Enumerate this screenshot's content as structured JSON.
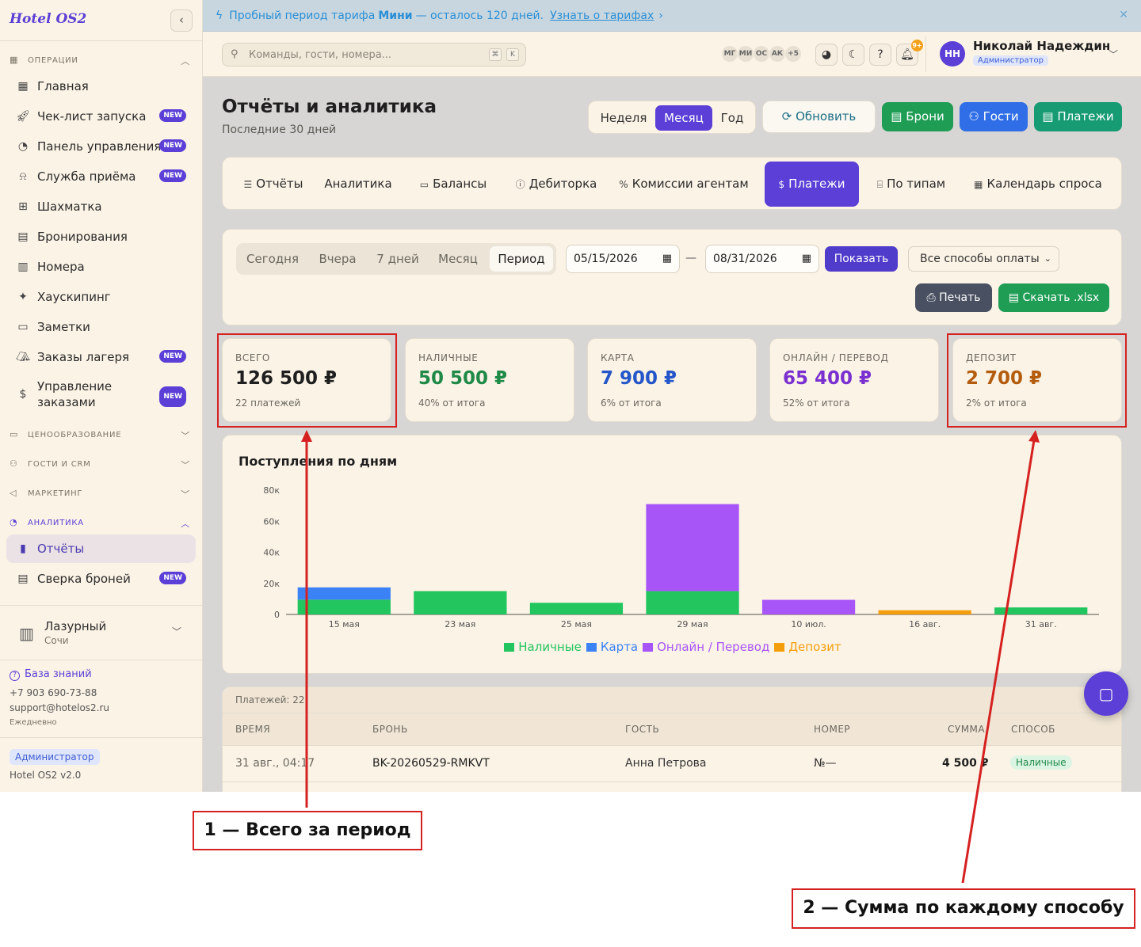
{
  "sidebar": {
    "logo": "Hotel OS2",
    "sections": {
      "operations": "ОПЕРАЦИИ",
      "pricing": "ЦЕНООБРАЗОВАНИЕ",
      "guests": "ГОСТИ И CRM",
      "marketing": "МАРКЕТИНГ",
      "analytics": "АНАЛИТИКА"
    },
    "items": [
      {
        "label": "Главная",
        "icon": "grid-icon",
        "badge": ""
      },
      {
        "label": "Чек-лист запуска",
        "icon": "rocket-icon",
        "badge": "NEW"
      },
      {
        "label": "Панель управления",
        "icon": "gauge-icon",
        "badge": "NEW"
      },
      {
        "label": "Служба приёма",
        "icon": "bell-desk-icon",
        "badge": "NEW"
      },
      {
        "label": "Шахматка",
        "icon": "table-grid-icon",
        "badge": ""
      },
      {
        "label": "Бронирования",
        "icon": "clipboard-icon",
        "badge": ""
      },
      {
        "label": "Номера",
        "icon": "building-icon",
        "badge": ""
      },
      {
        "label": "Хаускипинг",
        "icon": "sparkle-icon",
        "badge": ""
      },
      {
        "label": "Заметки",
        "icon": "note-icon",
        "badge": ""
      },
      {
        "label": "Заказы лагеря",
        "icon": "tent-icon",
        "badge": "NEW"
      },
      {
        "label": "Управление заказами",
        "icon": "receipt-dollar-icon",
        "badge": "NEW"
      }
    ],
    "analytics_items": [
      {
        "label": "Отчёты",
        "icon": "bar-chart-icon",
        "badge": ""
      },
      {
        "label": "Сверка броней",
        "icon": "doc-check-icon",
        "badge": "NEW"
      }
    ],
    "hotel": {
      "name": "Лазурный",
      "city": "Сочи"
    },
    "help": {
      "kb": "База знаний",
      "phone": "+7 903 690-73-88",
      "email": "support@hotelos2.ru",
      "hours": "Ежедневно"
    },
    "role": "Администратор",
    "version": "Hotel OS2 v2.0"
  },
  "trial": {
    "text_before": "Пробный период тарифа",
    "plan": "Мини",
    "text_after": "— осталось 120 дней.",
    "link": "Узнать о тарифах",
    "arrow": "›",
    "close": "✕"
  },
  "topbar": {
    "search_placeholder": "Команды, гости, номера...",
    "kbd1": "⌘",
    "kbd2": "K",
    "avatars": [
      "МГ",
      "МИ",
      "ОС",
      "АК",
      "+5"
    ],
    "notif_count": "9+",
    "user": {
      "initials": "НН",
      "name": "Николай Надеждин",
      "role": "Администратор"
    }
  },
  "page": {
    "title": "Отчёты и аналитика",
    "subtitle": "Последние 30 дней"
  },
  "period_toggle": {
    "week": "Неделя",
    "month": "Месяц",
    "year": "Год",
    "active": "Месяц"
  },
  "actions": {
    "refresh": "Обновить",
    "bookings": "Брони",
    "guests": "Гости",
    "payments": "Платежи"
  },
  "tabs": [
    {
      "label": "Отчёты",
      "icon": "list-icon"
    },
    {
      "label": "Аналитика",
      "icon": ""
    },
    {
      "label": "Балансы",
      "icon": "card-icon"
    },
    {
      "label": "Дебиторка",
      "icon": "alert-circle-icon"
    },
    {
      "label": "Комиссии агентам",
      "icon": "percent-icon"
    },
    {
      "label": "Платежи",
      "icon": "dollar-icon"
    },
    {
      "label": "По типам",
      "icon": "bed-icon"
    },
    {
      "label": "Календарь спроса",
      "icon": "calendar-icon"
    }
  ],
  "filters": {
    "quick": [
      "Сегодня",
      "Вчера",
      "7 дней",
      "Месяц",
      "Период"
    ],
    "active_quick": "Период",
    "date_from": "05/15/2026",
    "date_to": "08/31/2026",
    "dash": "—",
    "show": "Показать",
    "method_select": "Все способы оплаты",
    "print": "Печать",
    "xlsx": "Скачать .xlsx"
  },
  "summary": [
    {
      "label": "ВСЕГО",
      "value": "126 500 ₽",
      "sub": "22 платежей",
      "color": "#1f1f1f"
    },
    {
      "label": "НАЛИЧНЫЕ",
      "value": "50 500 ₽",
      "sub": "40% от итога",
      "color": "#1f8a48"
    },
    {
      "label": "КАРТА",
      "value": "7 900 ₽",
      "sub": "6% от итога",
      "color": "#2456c9"
    },
    {
      "label": "ОНЛАЙН / ПЕРЕВОД",
      "value": "65 400 ₽",
      "sub": "52% от итога",
      "color": "#7a2fd0"
    },
    {
      "label": "ДЕПОЗИТ",
      "value": "2 700 ₽",
      "sub": "2% от итога",
      "color": "#b35c0e"
    }
  ],
  "chart_data": {
    "type": "bar",
    "title": "Поступления по дням",
    "stacked": true,
    "categories": [
      "15 мая",
      "23 мая",
      "25 мая",
      "29 мая",
      "10 июл.",
      "16 авг.",
      "31 авг."
    ],
    "series": [
      {
        "name": "Наличные",
        "color": "#22c55e",
        "values": [
          9500,
          15000,
          7500,
          15000,
          0,
          0,
          4500
        ]
      },
      {
        "name": "Карта",
        "color": "#3b82f6",
        "values": [
          7900,
          0,
          0,
          0,
          0,
          0,
          0
        ]
      },
      {
        "name": "Онлайн / Перевод",
        "color": "#a855f7",
        "values": [
          0,
          0,
          0,
          56000,
          9400,
          0,
          0
        ]
      },
      {
        "name": "Депозит",
        "color": "#f59e0b",
        "values": [
          0,
          0,
          0,
          0,
          0,
          2700,
          0
        ]
      }
    ],
    "yticks": [
      "0",
      "20к",
      "40к",
      "60к",
      "80к"
    ],
    "ylim": [
      0,
      80000
    ],
    "legend": "bottom"
  },
  "table": {
    "count": "Платежей: 22",
    "headers": {
      "time": "ВРЕМЯ",
      "booking": "БРОНЬ",
      "guest": "ГОСТЬ",
      "room": "НОМЕР",
      "sum": "СУММА",
      "method": "СПОСОБ"
    },
    "rows": [
      {
        "time": "31 авг., 04:17",
        "booking": "BK-20260529-RMKVT",
        "guest": "Анна Петрова",
        "room": "№—",
        "sum": "4 500 ₽",
        "method": "Наличные"
      }
    ]
  },
  "annotations": {
    "callout1": "1 — Всего за период",
    "callout2": "2 — Сумма по каждому способу"
  }
}
